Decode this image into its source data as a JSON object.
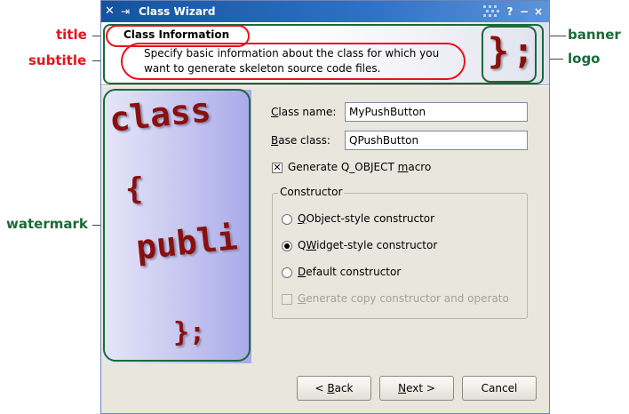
{
  "window": {
    "title": "Class Wizard",
    "titlebar_buttons": {
      "help": "?",
      "minimize": "−",
      "close": "×"
    }
  },
  "header": {
    "title": "Class Information",
    "subtitle": "Specify basic information about the class for which you want to generate skeleton source code files.",
    "logo": "};"
  },
  "watermark": {
    "lines": [
      "class",
      "{",
      "publi",
      "};"
    ]
  },
  "form": {
    "class_name_label": {
      "pre": "",
      "mnemonic": "C",
      "post": "lass name:"
    },
    "class_name_value": "MyPushButton",
    "base_class_label": {
      "pre": "",
      "mnemonic": "B",
      "post": "ase class:"
    },
    "base_class_value": "QPushButton",
    "generate_macro": {
      "pre": "Generate Q_OBJECT ",
      "mnemonic": "m",
      "post": "acro",
      "checked": true
    },
    "constructor_group": {
      "title": "Constructor",
      "options": [
        {
          "pre": "",
          "mnemonic": "Q",
          "post": "Object-style constructor",
          "selected": false
        },
        {
          "pre": "Q",
          "mnemonic": "W",
          "post": "idget-style constructor",
          "selected": true
        },
        {
          "pre": "",
          "mnemonic": "D",
          "post": "efault constructor",
          "selected": false
        }
      ],
      "copy_ctor": {
        "pre": "",
        "mnemonic": "G",
        "post": "enerate copy constructor and operato",
        "enabled": false
      }
    }
  },
  "buttons": {
    "back": {
      "pre": "< ",
      "mnemonic": "B",
      "post": "ack"
    },
    "next": {
      "pre": "",
      "mnemonic": "N",
      "post": "ext >"
    },
    "cancel": "Cancel"
  },
  "callouts": {
    "title": "title",
    "subtitle": "subtitle",
    "watermark": "watermark",
    "banner": "banner",
    "logo": "logo"
  },
  "colors": {
    "callout_red": "#e8121b",
    "callout_green": "#1a6a3a",
    "titlebar": "#15539e"
  }
}
